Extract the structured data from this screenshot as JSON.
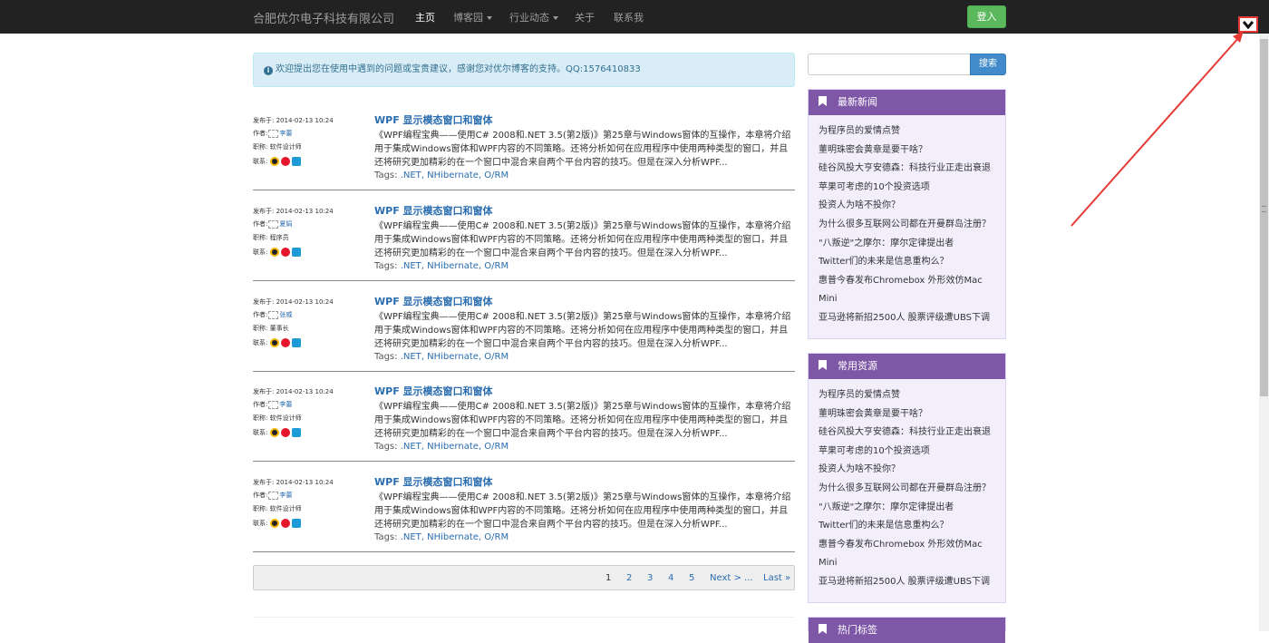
{
  "navbar": {
    "brand": "合肥优尔电子科技有限公司",
    "items": [
      {
        "label": "主页",
        "active": true,
        "dropdown": false
      },
      {
        "label": "博客园",
        "active": false,
        "dropdown": true
      },
      {
        "label": "行业动态",
        "active": false,
        "dropdown": true
      },
      {
        "label": "关于",
        "active": false,
        "dropdown": false
      },
      {
        "label": "联系我",
        "active": false,
        "dropdown": false
      }
    ],
    "login_label": "登入",
    "corner_icon": "chevron-down-icon"
  },
  "notice": {
    "icon": "info-icon",
    "text": "欢迎提出您在使用中遇到的问题或宝贵建议，感谢您对优尔博客的支持。QQ:1576410833"
  },
  "articles": [
    {
      "date": "发布于: 2014-02-13 10:24",
      "author_label": "作者:",
      "author": "李蕾",
      "role": "职称: 软件设计师",
      "contact_label": "联系:",
      "title": "WPF 显示模态窗口和窗体",
      "summary": "《WPF编程宝典——使用C# 2008和.NET 3.5(第2版)》第25章与Windows窗体的互操作，本章将介绍用于集成Windows窗体和WPF内容的不同策略。还将分析如何在应用程序中使用两种类型的窗口，并且还将研究更加精彩的在一个窗口中混合来自两个平台内容的技巧。但是在深入分析WPF...",
      "tags_label": "Tags:",
      "tags": ".NET, NHibernate, O/RM"
    },
    {
      "date": "发布于: 2014-02-13 10:24",
      "author_label": "作者:",
      "author": "夏娟",
      "role": "职称: 程序员",
      "contact_label": "联系:",
      "title": "WPF 显示模态窗口和窗体",
      "summary": "《WPF编程宝典——使用C# 2008和.NET 3.5(第2版)》第25章与Windows窗体的互操作，本章将介绍用于集成Windows窗体和WPF内容的不同策略。还将分析如何在应用程序中使用两种类型的窗口，并且还将研究更加精彩的在一个窗口中混合来自两个平台内容的技巧。但是在深入分析WPF...",
      "tags_label": "Tags:",
      "tags": ".NET, NHibernate, O/RM"
    },
    {
      "date": "发布于: 2014-02-13 10:24",
      "author_label": "作者:",
      "author": "张威",
      "role": "职称: 董事长",
      "contact_label": "联系:",
      "title": "WPF 显示模态窗口和窗体",
      "summary": "《WPF编程宝典——使用C# 2008和.NET 3.5(第2版)》第25章与Windows窗体的互操作，本章将介绍用于集成Windows窗体和WPF内容的不同策略。还将分析如何在应用程序中使用两种类型的窗口，并且还将研究更加精彩的在一个窗口中混合来自两个平台内容的技巧。但是在深入分析WPF...",
      "tags_label": "Tags:",
      "tags": ".NET, NHibernate, O/RM"
    },
    {
      "date": "发布于: 2014-02-13 10:24",
      "author_label": "作者:",
      "author": "李蕾",
      "role": "职称: 软件设计师",
      "contact_label": "联系:",
      "title": "WPF 显示模态窗口和窗体",
      "summary": "《WPF编程宝典——使用C# 2008和.NET 3.5(第2版)》第25章与Windows窗体的互操作，本章将介绍用于集成Windows窗体和WPF内容的不同策略。还将分析如何在应用程序中使用两种类型的窗口，并且还将研究更加精彩的在一个窗口中混合来自两个平台内容的技巧。但是在深入分析WPF...",
      "tags_label": "Tags:",
      "tags": ".NET, NHibernate, O/RM"
    },
    {
      "date": "发布于: 2014-02-13 10:24",
      "author_label": "作者:",
      "author": "李蕾",
      "role": "职称: 软件设计师",
      "contact_label": "联系:",
      "title": "WPF 显示模态窗口和窗体",
      "summary": "《WPF编程宝典——使用C# 2008和.NET 3.5(第2版)》第25章与Windows窗体的互操作，本章将介绍用于集成Windows窗体和WPF内容的不同策略。还将分析如何在应用程序中使用两种类型的窗口，并且还将研究更加精彩的在一个窗口中混合来自两个平台内容的技巧。但是在深入分析WPF...",
      "tags_label": "Tags:",
      "tags": ".NET, NHibernate, O/RM"
    }
  ],
  "pagination": {
    "pages": [
      "1",
      "2",
      "3",
      "4",
      "5"
    ],
    "current": "1",
    "next_label": "Next > ...",
    "last_label": "Last »"
  },
  "sidebar": {
    "search_value": "",
    "search_button": "搜索",
    "panels": [
      {
        "title": "最新新闻",
        "items": [
          "为程序员的爱情点赞",
          "董明珠密会黄章是要干啥？",
          "硅谷风投大亨安德森：科技行业正走出衰退",
          "苹果可考虑的10个投资选项",
          "投资人为啥不投你？",
          "为什么很多互联网公司都在开曼群岛注册？",
          "\"八叛逆\"之摩尔：摩尔定律提出者",
          "Twitter们的未来是信息重构么？",
          "惠普今春发布Chromebox 外形效仿Mac Mini",
          "亚马逊将新招2500人 股票评级遭UBS下调"
        ]
      },
      {
        "title": "常用资源",
        "items": [
          "为程序员的爱情点赞",
          "董明珠密会黄章是要干啥？",
          "硅谷风投大亨安德森：科技行业正走出衰退",
          "苹果可考虑的10个投资选项",
          "投资人为啥不投你？",
          "为什么很多互联网公司都在开曼群岛注册？",
          "\"八叛逆\"之摩尔：摩尔定律提出者",
          "Twitter们的未来是信息重构么？",
          "惠普今春发布Chromebox 外形效仿Mac Mini",
          "亚马逊将新招2500人 股票评级遭UBS下调"
        ]
      },
      {
        "title": "热门标签",
        "items": []
      }
    ]
  },
  "colors": {
    "navbar_bg": "#222222",
    "login_green": "#5cb85c",
    "notice_bg": "#d9edf7",
    "panel_header": "#7e57a7",
    "panel_bg": "#f2eefc",
    "link": "#2a6db0",
    "annotation_red": "#e53935"
  }
}
